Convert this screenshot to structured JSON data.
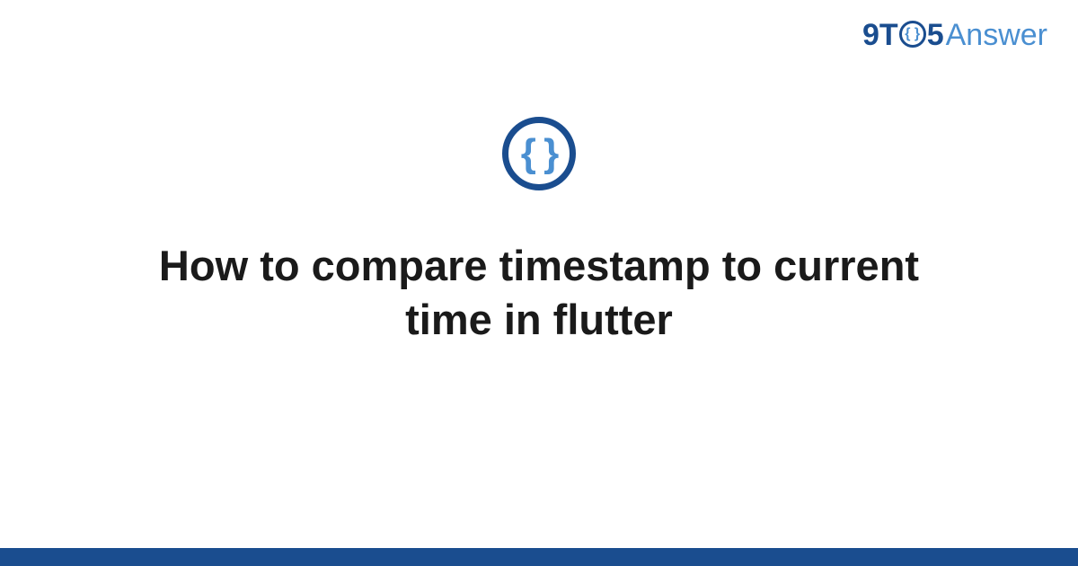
{
  "brand": {
    "part1": "9",
    "part2": "T",
    "ring_inner": "{ }",
    "part3": "5",
    "part4": "Answer"
  },
  "logo": {
    "braces": "{ }"
  },
  "title": "How to compare timestamp to current time in flutter",
  "colors": {
    "primary": "#1a4d8f",
    "accent": "#4a8fd1"
  }
}
